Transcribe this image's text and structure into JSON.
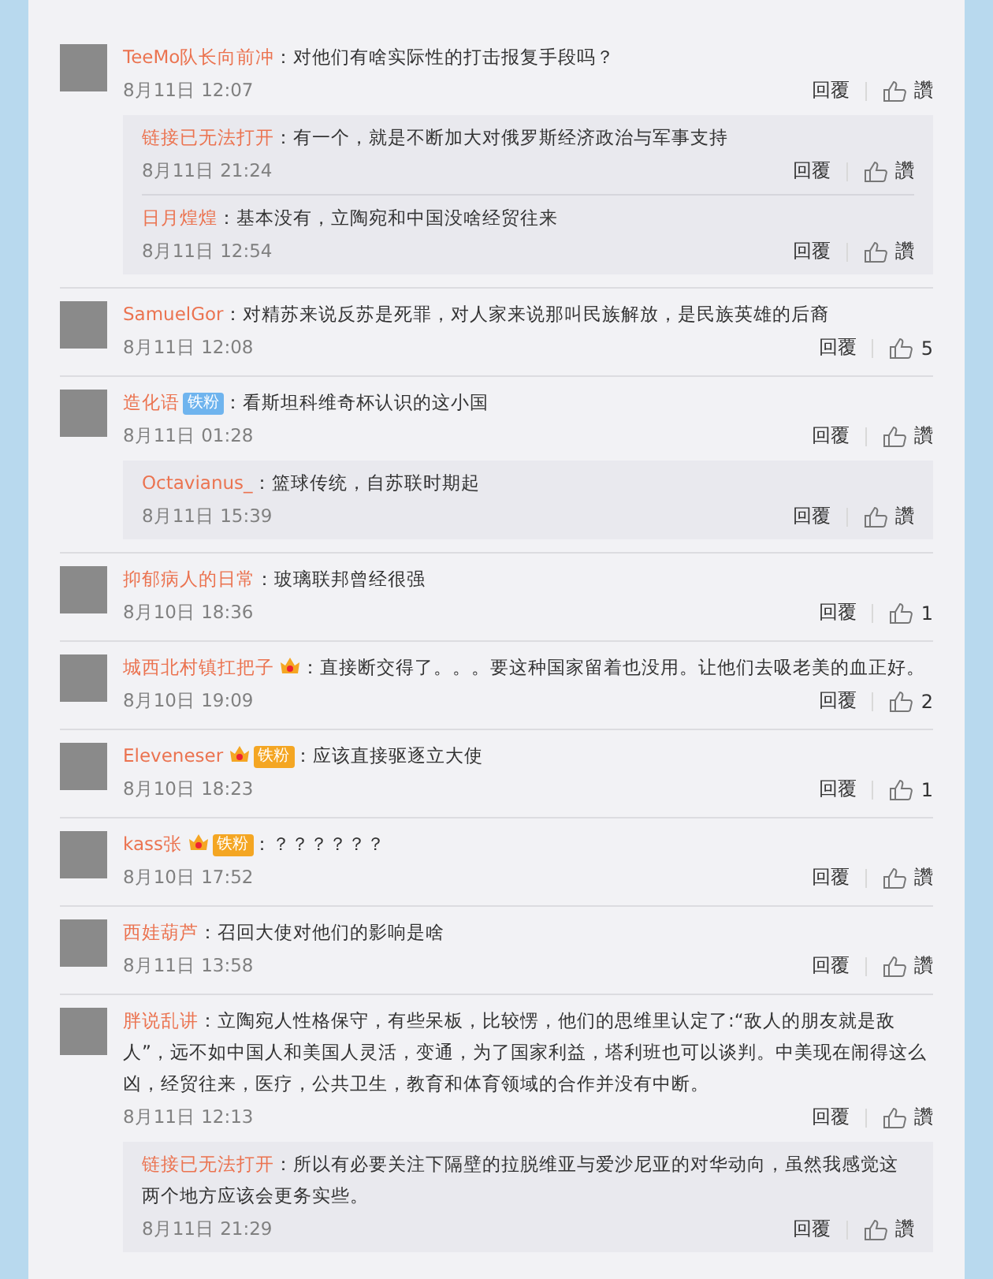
{
  "comments": [
    {
      "user": "TeeMo队长向前冲",
      "crown": false,
      "text": "：对他们有啥实际性的打击报复手段吗？",
      "time": "8月11日 12:07",
      "reply_label": "回覆",
      "like": "讚",
      "replies": [
        {
          "user": "链接已无法打开",
          "text": "：有一个，就是不断加大对俄罗斯经济政治与军事支持",
          "time": "8月11日 21:24",
          "reply_label": "回覆",
          "like": "讚"
        },
        {
          "user": "日月煌煌",
          "text": "：基本没有，立陶宛和中国没啥经贸往来",
          "time": "8月11日 12:54",
          "reply_label": "回覆",
          "like": "讚"
        }
      ]
    },
    {
      "user": "SamuelGor",
      "crown": false,
      "text": "：对精苏来说反苏是死罪，对人家来说那叫民族解放，是民族英雄的后裔",
      "time": "8月11日 12:08",
      "reply_label": "回覆",
      "like": "5"
    },
    {
      "user": "造化语",
      "crown": false,
      "fan_badge": {
        "label": "铁粉",
        "color": "#6fb4ee"
      },
      "text": "：看斯坦科维奇杯认识的这小国",
      "time": "8月11日 01:28",
      "reply_label": "回覆",
      "like": "讚",
      "replies": [
        {
          "user": "Octavianus_",
          "text": "：篮球传统，自苏联时期起",
          "time": "8月11日 15:39",
          "reply_label": "回覆",
          "like": "讚"
        }
      ]
    },
    {
      "user": "抑郁病人的日常",
      "crown": false,
      "text": "：玻璃联邦曾经很强",
      "time": "8月10日 18:36",
      "reply_label": "回覆",
      "like": "1"
    },
    {
      "user": "城西北村镇扛把子",
      "crown": true,
      "text": "：直接断交得了。。。要这种国家留着也没用。让他们去吸老美的血正好。",
      "time": "8月10日 19:09",
      "reply_label": "回覆",
      "like": "2"
    },
    {
      "user": "Eleveneser",
      "crown": true,
      "fan_badge": {
        "label": "铁粉",
        "color": "#f4a623"
      },
      "text": "：应该直接驱逐立大使",
      "time": "8月10日 18:23",
      "reply_label": "回覆",
      "like": "1"
    },
    {
      "user": "kass张",
      "crown": true,
      "fan_badge": {
        "label": "铁粉",
        "color": "#f4a623"
      },
      "text": "：？？？？？？",
      "time": "8月10日 17:52",
      "reply_label": "回覆",
      "like": "讚"
    },
    {
      "user": "西娃葫芦",
      "crown": false,
      "text": "：召回大使对他们的影响是啥",
      "time": "8月11日 13:58",
      "reply_label": "回覆",
      "like": "讚"
    },
    {
      "user": "胖说乱讲",
      "crown": false,
      "text": "：立陶宛人性格保守，有些呆板，比较愣，他们的思维里认定了:“敌人的朋友就是敌人”，远不如中国人和美国人灵活，变通，为了国家利益，塔利班也可以谈判。中美现在闹得这么凶，经贸往来，医疗，公共卫生，教育和体育领域的合作并没有中断。",
      "time": "8月11日 12:13",
      "reply_label": "回覆",
      "like": "讚",
      "replies": [
        {
          "user": "链接已无法打开",
          "text": "：所以有必要关注下隔壁的拉脱维亚与爱沙尼亚的对华动向，虽然我感觉这两个地方应该会更务实些。",
          "time": "8月11日 21:29",
          "reply_label": "回覆",
          "like": "讚"
        }
      ]
    }
  ]
}
